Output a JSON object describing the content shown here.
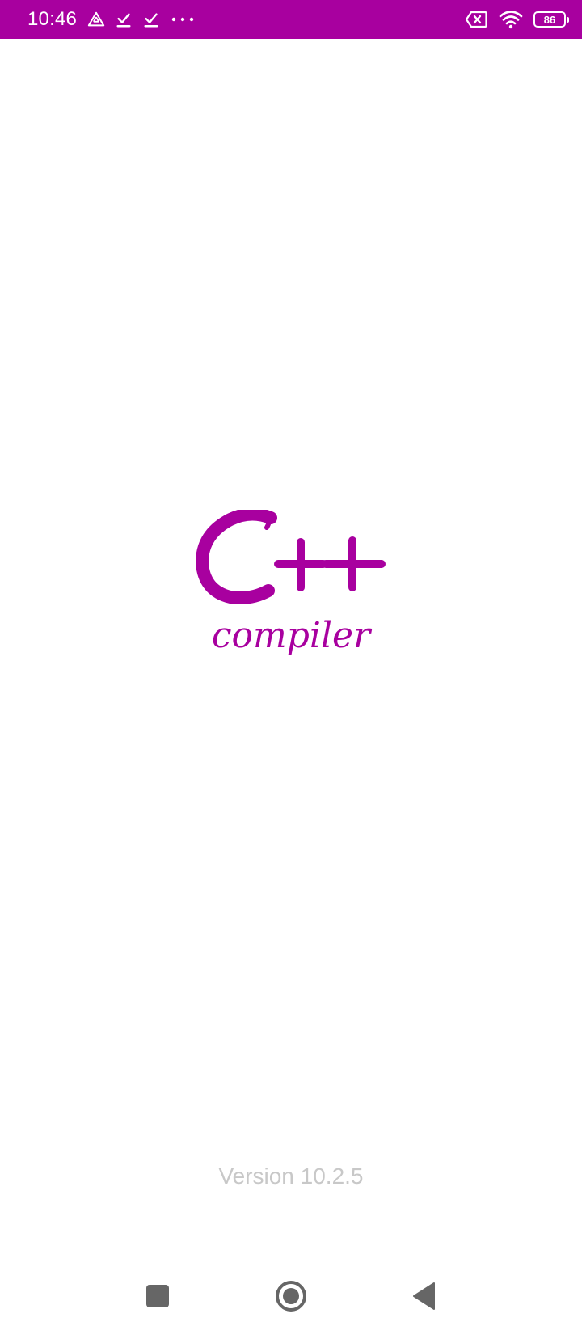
{
  "status_bar": {
    "time": "10:46",
    "battery_level": "86",
    "left_icons": [
      "drive-icon",
      "download-done-icon",
      "download-done-icon",
      "more-dots-icon"
    ],
    "right_icons": [
      "sim-x-icon",
      "wifi-icon",
      "battery-icon"
    ],
    "background_color": "#a8009f"
  },
  "splash": {
    "logo_title": "C++",
    "logo_subtitle": "compiler",
    "logo_color": "#a8009f",
    "version_text": "Version 10.2.5"
  },
  "nav_bar": {
    "buttons": [
      "recents-button",
      "home-button",
      "back-button"
    ]
  }
}
